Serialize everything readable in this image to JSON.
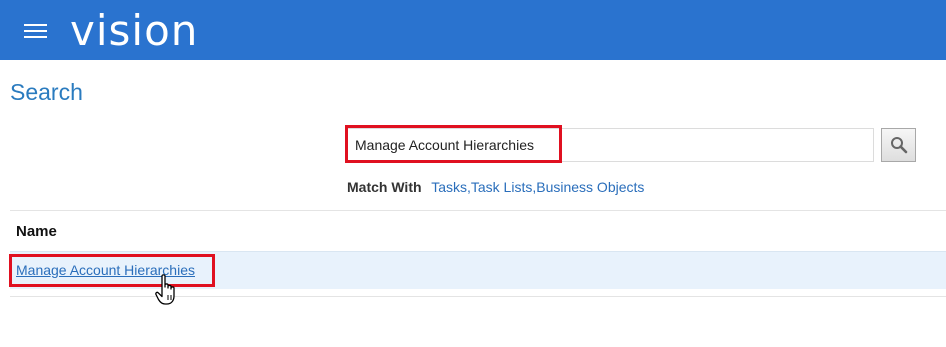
{
  "header": {
    "brand": "vision",
    "menu_icon": "hamburger-menu-icon",
    "background_color": "#2a73cf"
  },
  "page": {
    "title": "Search"
  },
  "search": {
    "value": "Manage Account Hierarchies",
    "button_icon": "magnifier-icon"
  },
  "match_with": {
    "label": "Match With",
    "options": [
      "Tasks",
      "Task Lists",
      "Business Objects"
    ]
  },
  "results": {
    "column_header": "Name",
    "rows": [
      {
        "name": "Manage Account Hierarchies"
      }
    ]
  },
  "highlight_color": "#e01020",
  "link_color": "#2a6ebb"
}
